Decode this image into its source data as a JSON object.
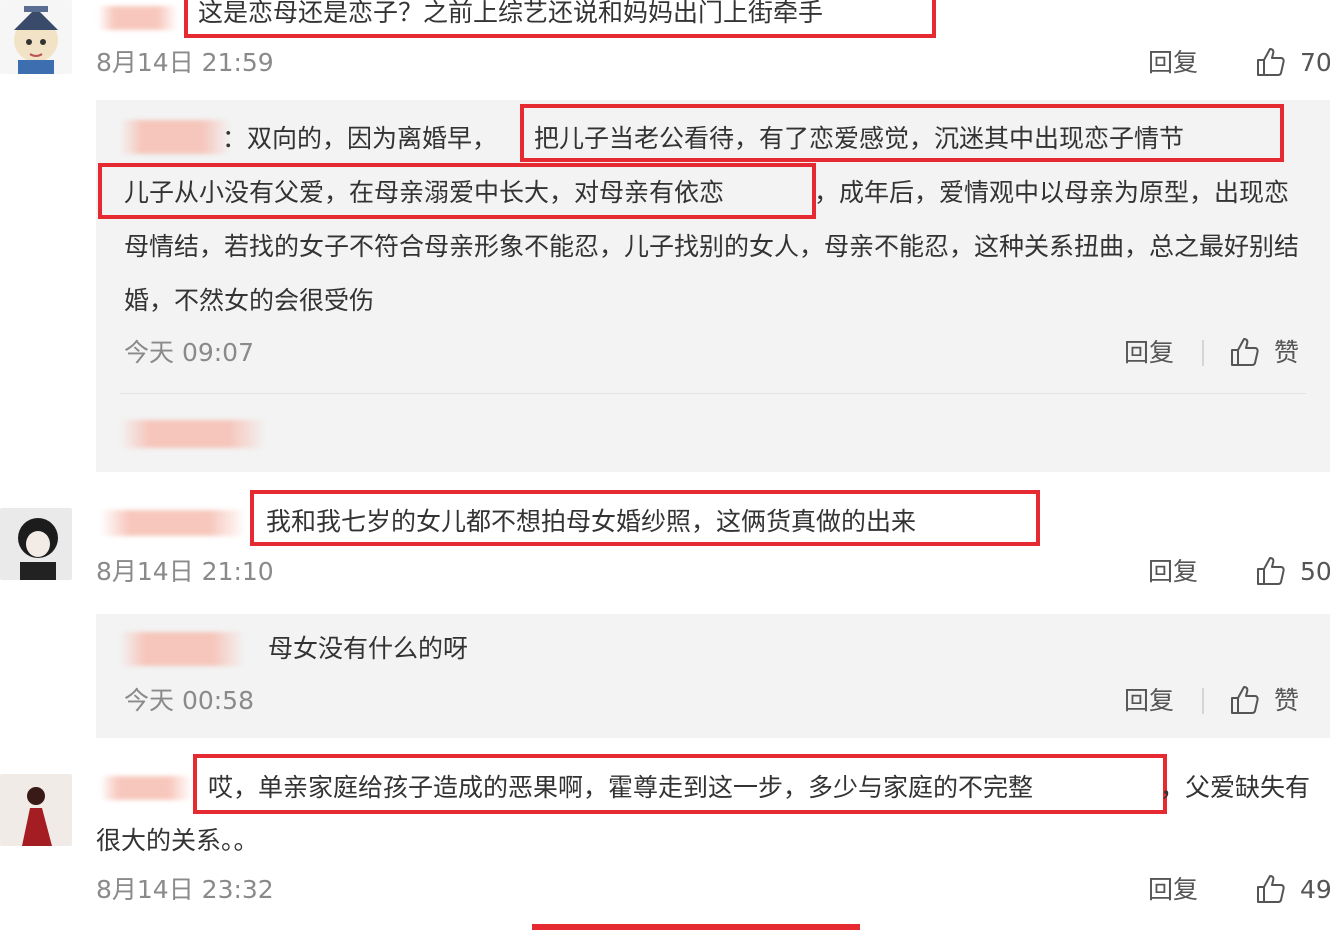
{
  "comment1": {
    "text": "这是恋母还是恋子？之前上综艺还说和妈妈出门上街牵手",
    "time": "8月14日 21:59",
    "reply_label": "回复",
    "like_count": "70"
  },
  "reply1": {
    "prefix": "：双向的，因为离婚早，",
    "highlight1": "把儿子当老公看待，有了恋爱感觉，沉迷其中出现恋子情节",
    "highlight2": "儿子从小没有父爱，在母亲溺爱中长大，对母亲有依恋",
    "rest": "，成年后，爱情观中以母亲为原型，出现恋母情结，若找的女子不符合母亲形象不能忍，儿子找别的女人，母亲不能忍，这种关系扭曲，总之最好别结婚，不然女的会很受伤",
    "time": "今天 09:07",
    "reply_label": "回复",
    "like_label": "赞"
  },
  "comment2": {
    "text": "我和我七岁的女儿都不想拍母女婚纱照，这俩货真做的出来",
    "time": "8月14日 21:10",
    "reply_label": "回复",
    "like_count": "50"
  },
  "reply2": {
    "text": "母女没有什么的呀",
    "time": "今天 00:58",
    "reply_label": "回复",
    "like_label": "赞"
  },
  "comment3": {
    "highlight": "哎，单亲家庭给孩子造成的恶果啊，霍尊走到这一步，多少与家庭的不完整",
    "tail1": "，父爱缺失有",
    "tail2": "很大的关系。。",
    "time": "8月14日 23:32",
    "reply_label": "回复",
    "like_count": "49"
  },
  "colors": {
    "highlight_frame": "#e52a32",
    "reply_background": "#f3f3f3",
    "timestamp": "#8a8a8a"
  },
  "icons": [
    "thumbs-up-icon"
  ]
}
